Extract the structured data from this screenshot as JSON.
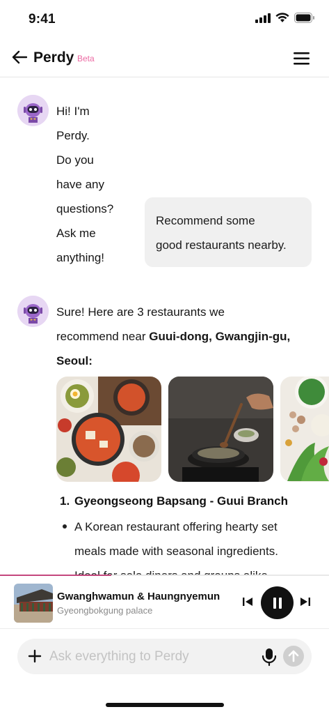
{
  "status_bar": {
    "time": "9:41"
  },
  "header": {
    "title": "Perdy",
    "badge": "Beta"
  },
  "messages": {
    "greeting": [
      "Hi! I'm Perdy.",
      "Do you have any questions?",
      "Ask me anything!"
    ],
    "user": [
      "Recommend some",
      "good restaurants nearby."
    ],
    "reply_intro_1": "Sure! Here are 3 restaurants we",
    "reply_intro_2": "recommend near ",
    "reply_location_1": "Guui-dong, Gwangjin-gu,",
    "reply_location_2": "Seoul:",
    "restaurants": [
      {
        "number": "1.",
        "name": "Gyeongseong Bapsang - Guui Branch",
        "description": [
          "A Korean restaurant offering hearty set",
          "meals made with seasonal ingredients.",
          "Ideal for solo diners and groups alike."
        ]
      }
    ]
  },
  "player": {
    "title": "Gwanghwamun & Haungnyemun",
    "subtitle": "Gyeongbokgung palace",
    "accent": "#c4477d"
  },
  "input": {
    "placeholder": "Ask everything to Perdy"
  },
  "icons": [
    "back-arrow-icon",
    "menu-icon",
    "plus-icon",
    "mic-icon",
    "send-arrow-icon",
    "prev-track-icon",
    "pause-icon",
    "next-track-icon",
    "signal-icon",
    "wifi-icon",
    "battery-icon"
  ],
  "colors": {
    "beta": "#ec6aa3",
    "bubble": "#f0f0f0",
    "avatar_bg": "#e7d7f3"
  }
}
